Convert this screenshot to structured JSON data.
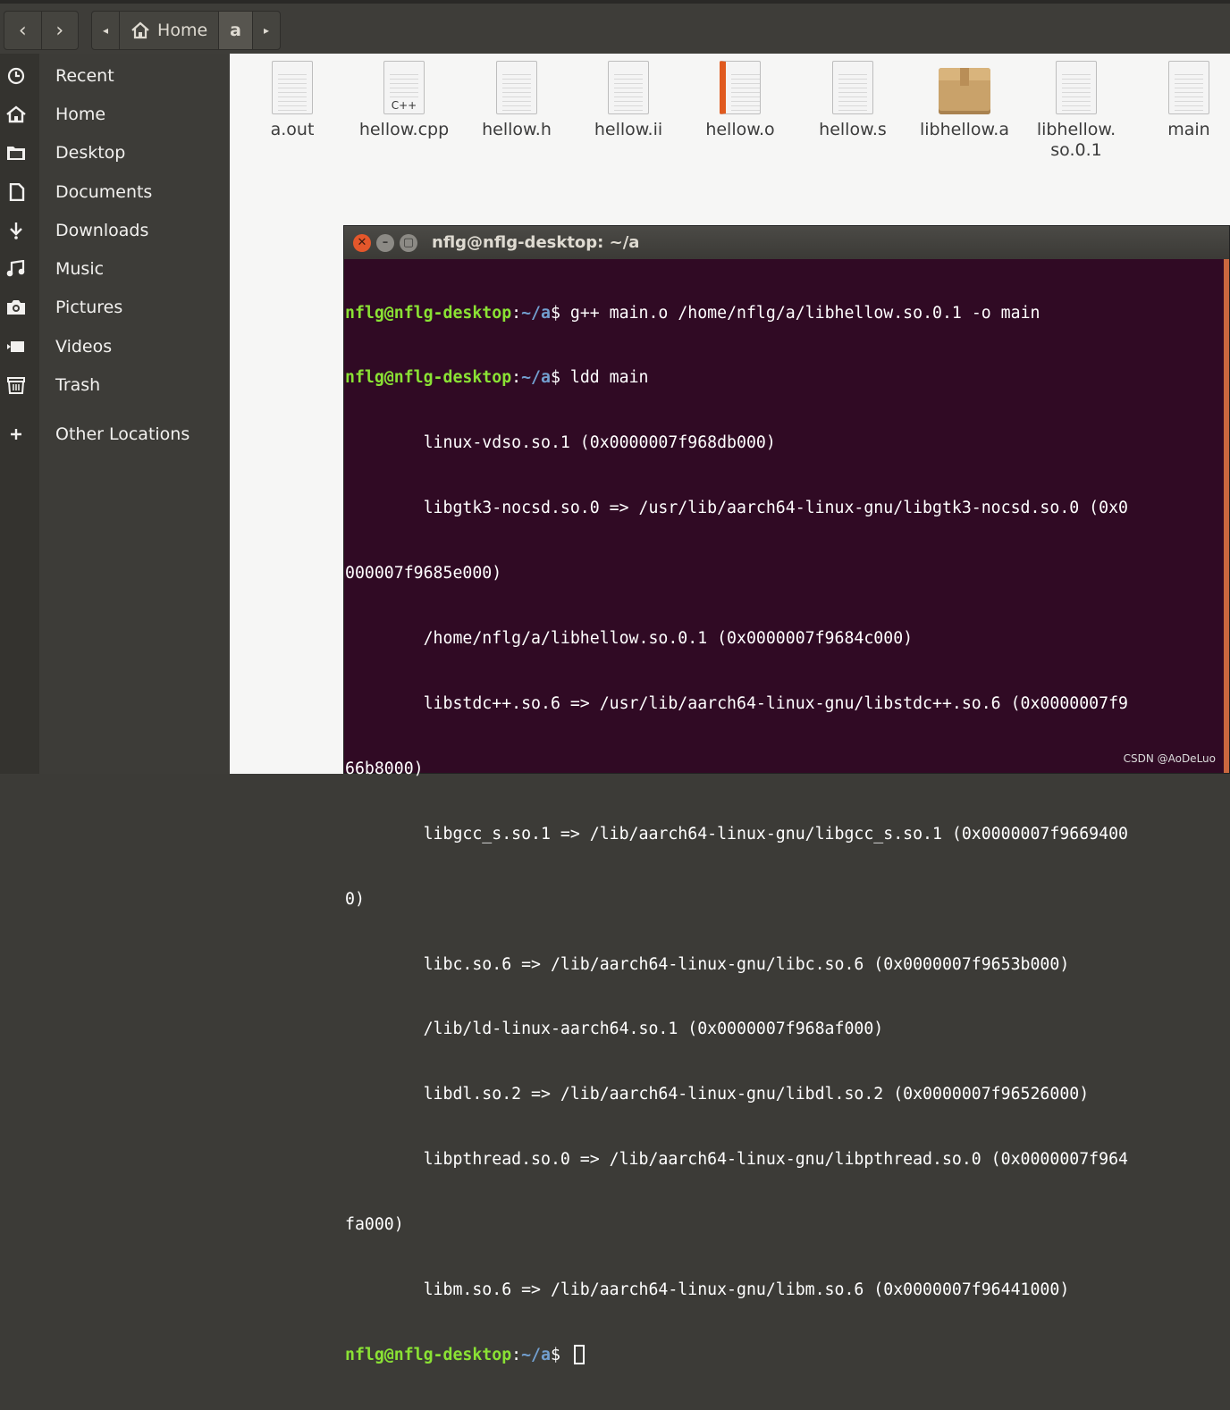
{
  "header": {
    "back_icon": "chevron-left-icon",
    "forward_icon": "chevron-right-icon",
    "crumb_left_arrow": "◂",
    "crumb_home_label": "Home",
    "crumb_current_label": "a",
    "crumb_right_arrow": "▸"
  },
  "sidebar": {
    "items": [
      {
        "label": "Recent",
        "icon": "clock-icon"
      },
      {
        "label": "Home",
        "icon": "home-icon"
      },
      {
        "label": "Desktop",
        "icon": "folder-icon"
      },
      {
        "label": "Documents",
        "icon": "document-icon"
      },
      {
        "label": "Downloads",
        "icon": "download-icon"
      },
      {
        "label": "Music",
        "icon": "music-icon"
      },
      {
        "label": "Pictures",
        "icon": "camera-icon"
      },
      {
        "label": "Videos",
        "icon": "video-icon"
      },
      {
        "label": "Trash",
        "icon": "trash-icon"
      },
      {
        "label": "Other Locations",
        "icon": "plus-icon"
      }
    ]
  },
  "files": [
    {
      "name": "a.out",
      "type": "text"
    },
    {
      "name": "hellow.cpp",
      "type": "cpp",
      "tag": "C++"
    },
    {
      "name": "hellow.h",
      "type": "header"
    },
    {
      "name": "hellow.ii",
      "type": "text"
    },
    {
      "name": "hellow.o",
      "type": "object"
    },
    {
      "name": "hellow.s",
      "type": "text"
    },
    {
      "name": "libhellow.a",
      "type": "archive"
    },
    {
      "name": "libhellow.",
      "name2": "so.0.1",
      "type": "text"
    },
    {
      "name": "main",
      "type": "text"
    }
  ],
  "terminal": {
    "title": "nflg@nflg-desktop: ~/a",
    "prompt_user": "nflg@nflg-desktop",
    "prompt_sep": ":",
    "prompt_path": "~/a",
    "prompt_end": "$ ",
    "commands": [
      "g++ main.o /home/nflg/a/libhellow.so.0.1 -o main",
      "ldd main"
    ],
    "output_lines": [
      "        linux-vdso.so.1 (0x0000007f968db000)",
      "        libgtk3-nocsd.so.0 => /usr/lib/aarch64-linux-gnu/libgtk3-nocsd.so.0 (0x0",
      "000007f9685e000)",
      "        /home/nflg/a/libhellow.so.0.1 (0x0000007f9684c000)",
      "        libstdc++.so.6 => /usr/lib/aarch64-linux-gnu/libstdc++.so.6 (0x0000007f9",
      "66b8000)",
      "        libgcc_s.so.1 => /lib/aarch64-linux-gnu/libgcc_s.so.1 (0x0000007f9669400",
      "0)",
      "        libc.so.6 => /lib/aarch64-linux-gnu/libc.so.6 (0x0000007f9653b000)",
      "        /lib/ld-linux-aarch64.so.1 (0x0000007f968af000)",
      "        libdl.so.2 => /lib/aarch64-linux-gnu/libdl.so.2 (0x0000007f96526000)",
      "        libpthread.so.0 => /lib/aarch64-linux-gnu/libpthread.so.0 (0x0000007f964",
      "fa000)",
      "        libm.so.6 => /lib/aarch64-linux-gnu/libm.so.6 (0x0000007f96441000)"
    ]
  },
  "watermark": "CSDN @AoDeLuo"
}
